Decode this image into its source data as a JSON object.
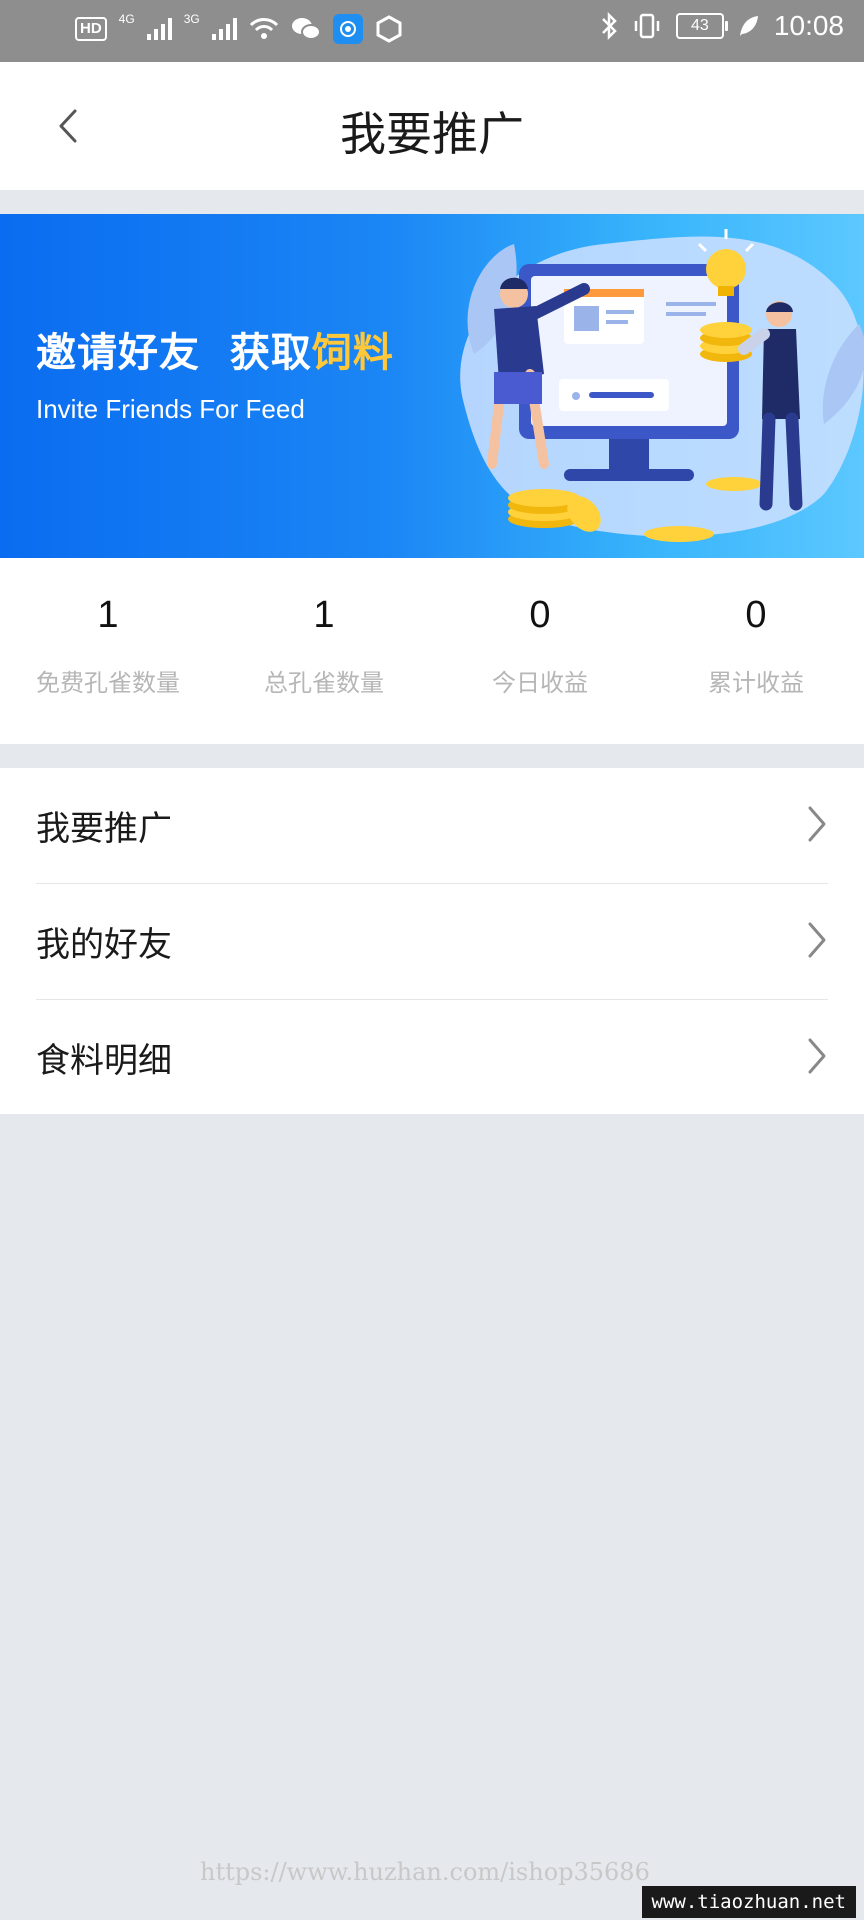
{
  "status_bar": {
    "hd": "HD",
    "net1": "4G",
    "net2": "3G",
    "battery": "43",
    "time": "10:08"
  },
  "header": {
    "title": "我要推广",
    "back_icon": "chevron-left-icon"
  },
  "banner": {
    "title_prefix": "邀请好友  获取",
    "title_highlight": "饲料",
    "subtitle": "Invite Friends For Feed",
    "highlight_color": "#ffc83a"
  },
  "stats": [
    {
      "value": "1",
      "label": "免费孔雀数量"
    },
    {
      "value": "1",
      "label": "总孔雀数量"
    },
    {
      "value": "0",
      "label": "今日收益"
    },
    {
      "value": "0",
      "label": "累计收益"
    }
  ],
  "menu": [
    {
      "label": "我要推广"
    },
    {
      "label": "我的好友"
    },
    {
      "label": "食料明细"
    }
  ],
  "watermark": {
    "url": "https://www.huzhan.com/ishop35686",
    "badge": "www.tiaozhuan.net"
  }
}
